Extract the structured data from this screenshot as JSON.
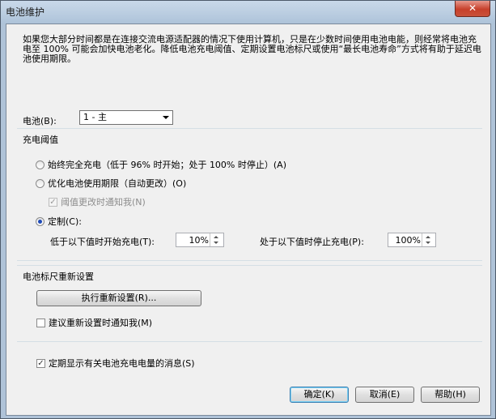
{
  "window": {
    "title": "电池维护",
    "close_glyph": "✕"
  },
  "intro": "如果您大部分时间都是在连接交流电源适配器的情况下使用计算机，只是在少数时间使用电池电能，则经常将电池充电至 100% 可能会加快电池老化。降低电池充电阈值、定期设置电池标尺或使用“最长电池寿命”方式将有助于延迟电池使用期限。",
  "battery": {
    "label": "电池(B):",
    "selected": "1 - 主"
  },
  "charge_group": {
    "title": "充电阈值",
    "option_full": "始终完全充电（低于 96% 时开始；处于 100% 时停止）(A)",
    "option_optimize": "优化电池使用期限（自动更改）(O)",
    "notify_change": "阈值更改时通知我(N)",
    "option_custom": "定制(C):",
    "start_label": "低于以下值时开始充电(T):",
    "start_value": "10%",
    "stop_label": "处于以下值时停止充电(P):",
    "stop_value": "100%",
    "check_glyph": "✓"
  },
  "gauge_group": {
    "title": "电池标尺重新设置",
    "reset_button": "执行重新设置(R)...",
    "notify_reset": "建议重新设置时通知我(M)"
  },
  "periodic_msg": "定期显示有关电池充电电量的消息(S)",
  "buttons": {
    "ok": "确定(K)",
    "cancel": "取消(E)",
    "help": "帮助(H)"
  }
}
